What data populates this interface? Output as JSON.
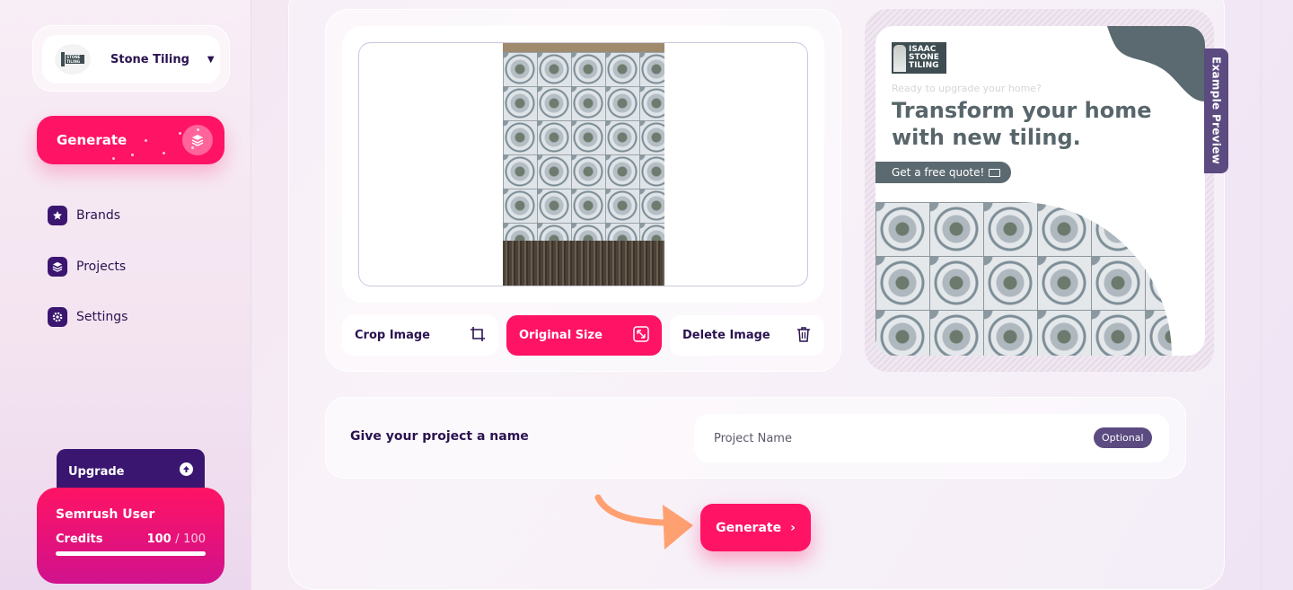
{
  "sidebar": {
    "brand": {
      "name": "Stone Tiling",
      "logo_text": "STONE TILING"
    },
    "generate_label": "Generate",
    "nav": [
      {
        "label": "Brands",
        "icon": "star-icon"
      },
      {
        "label": "Projects",
        "icon": "layers-icon"
      },
      {
        "label": "Settings",
        "icon": "gear-icon"
      }
    ],
    "upgrade_label": "Upgrade",
    "user": {
      "name": "Semrush User",
      "credits_label": "Credits",
      "credits_used": "100",
      "credits_sep": "/",
      "credits_total": "100",
      "credits_fraction": 1.0
    }
  },
  "image_tools": {
    "crop_label": "Crop Image",
    "original_label": "Original Size",
    "delete_label": "Delete Image"
  },
  "preview": {
    "tab_label": "Example Preview",
    "logo_text": [
      "ISAAC",
      "STONE",
      "TILING"
    ],
    "tagline": "Ready to upgrade your home?",
    "headline": "Transform your home with new tiling.",
    "cta": "Get a free quote!"
  },
  "project": {
    "heading": "Give your project a name",
    "placeholder": "Project Name",
    "value": "",
    "optional_label": "Optional"
  },
  "generate_button": {
    "label": "Generate",
    "chevron": "›"
  },
  "colors": {
    "accent": "#ff1364",
    "navy": "#2a1250",
    "purple": "#3a1670",
    "muted_purple": "#5b4b80",
    "preview_slate": "#58666b",
    "arrow": "#ffa071"
  }
}
